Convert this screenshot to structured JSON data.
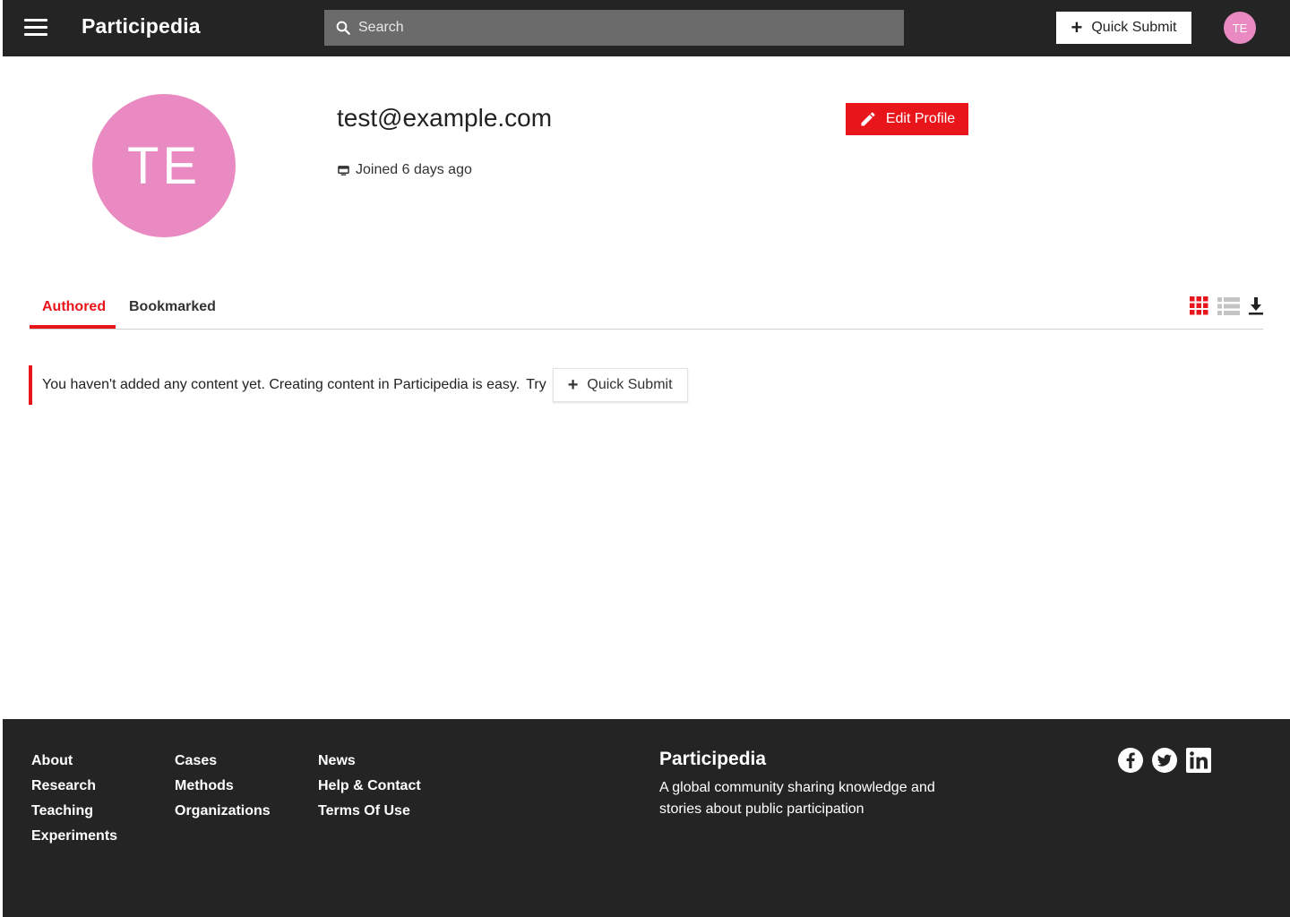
{
  "header": {
    "brand": "Participedia",
    "search_placeholder": "Search",
    "quick_submit_label": "Quick Submit",
    "avatar_initials": "TE"
  },
  "profile": {
    "avatar_initials": "TE",
    "name": "test@example.com",
    "joined": "Joined 6 days ago",
    "edit_label": "Edit Profile"
  },
  "tabs": [
    {
      "label": "Authored",
      "active": true
    },
    {
      "label": "Bookmarked",
      "active": false
    }
  ],
  "empty_state": {
    "message": "You haven't added any content yet. Creating content in Participedia is easy.",
    "try": "Try",
    "button_label": "Quick Submit"
  },
  "footer": {
    "col1": [
      "About",
      "Research",
      "Teaching",
      "Experiments"
    ],
    "col2": [
      "Cases",
      "Methods",
      "Organizations"
    ],
    "col3": [
      "News",
      "Help & Contact",
      "Terms Of Use"
    ],
    "brand": "Participedia",
    "tagline": "A global community sharing knowledge and stories about public participation",
    "social": [
      "facebook-icon",
      "twitter-icon",
      "linkedin-icon"
    ]
  },
  "colors": {
    "accent": "#e8161b",
    "avatar": "#e98bc2",
    "header_bg": "#242424"
  }
}
